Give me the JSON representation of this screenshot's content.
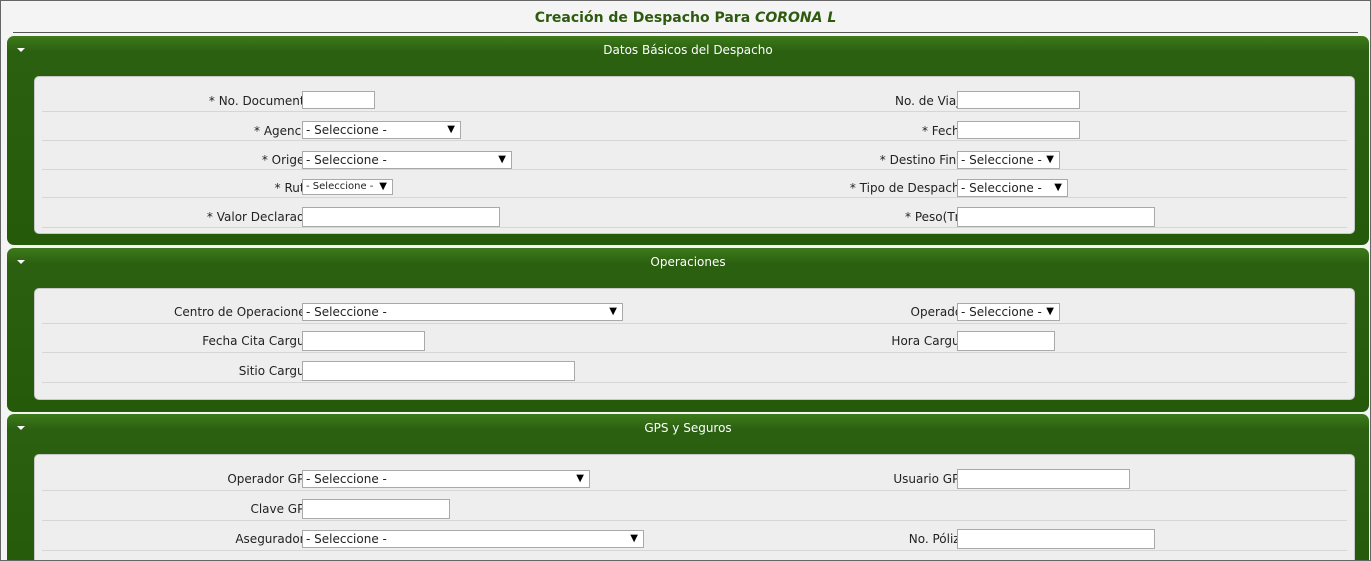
{
  "title": {
    "prefix": "Creación de Despacho Para",
    "company": "CORONA L"
  },
  "panels": {
    "basic": {
      "header": "Datos Básicos del Despacho",
      "doc_label": "* No. Documento:",
      "viaje_label": "No. de Viaje:",
      "agencia_label": "* Agencia:",
      "agencia_value": "- Seleccione -",
      "fecha_label": "* Fecha:",
      "origen_label": "* Origen:",
      "origen_value": "- Seleccione -",
      "destino_label": "* Destino Final:",
      "destino_value": "- Seleccione -",
      "ruta_label": "* Ruta:",
      "ruta_value": "- Seleccione -",
      "tipo_label": "* Tipo de Despacho:",
      "tipo_value": "- Seleccione -",
      "valor_label": "* Valor Declarado:",
      "peso_label": "* Peso(Tn):"
    },
    "ops": {
      "header": "Operaciones",
      "centro_label": "Centro de Operaciones:",
      "centro_value": "- Seleccione -",
      "operador_label": "Operador:",
      "operador_value": "- Seleccione -",
      "fecha_cita_label": "Fecha Cita Cargue:",
      "hora_label": "Hora Cargue:",
      "sitio_label": "Sitio Cargue:"
    },
    "gps": {
      "header": "GPS y Seguros",
      "op_gps_label": "Operador GPS:",
      "op_gps_value": "- Seleccione -",
      "usuario_label": "Usuario GPS:",
      "clave_label": "Clave GPS:",
      "aseg_label": "Aseguradora:",
      "aseg_value": "- Seleccione -",
      "poliza_label": "No. Póliza:"
    }
  },
  "icons": {
    "collapse": "triangle-down-icon",
    "dropdown": "dropdown-arrow-icon"
  },
  "colors": {
    "panel_green": "#245a0a",
    "title_green": "#2e5a10",
    "body_bg": "#eeeeee"
  }
}
